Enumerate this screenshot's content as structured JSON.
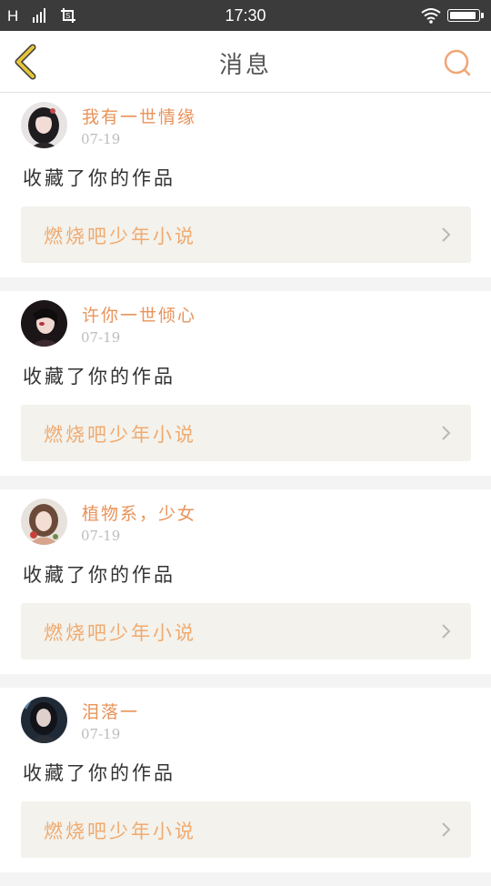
{
  "status_bar": {
    "carrier": "H",
    "time": "17:30",
    "battery_level": 0.95
  },
  "header": {
    "title": "消息",
    "back_icon": "chevron-left-icon",
    "search_icon": "search-icon"
  },
  "colors": {
    "accent": "#e9935a",
    "back_arrow": "#e6c53b",
    "status_bar": "#3b3b3b",
    "link_background": "#f3f2ec",
    "link_text": "#f0aa70"
  },
  "messages": [
    {
      "user": "我有一世情缘",
      "date": "07-19",
      "action": "收藏了你的作品",
      "work": "燃烧吧少年小说"
    },
    {
      "user": "许你一世倾心",
      "date": "07-19",
      "action": "收藏了你的作品",
      "work": "燃烧吧少年小说"
    },
    {
      "user": "植物系，少女",
      "date": "07-19",
      "action": "收藏了你的作品",
      "work": "燃烧吧少年小说"
    },
    {
      "user": "泪落一",
      "date": "07-19",
      "action": "收藏了你的作品",
      "work": "燃烧吧少年小说"
    }
  ]
}
